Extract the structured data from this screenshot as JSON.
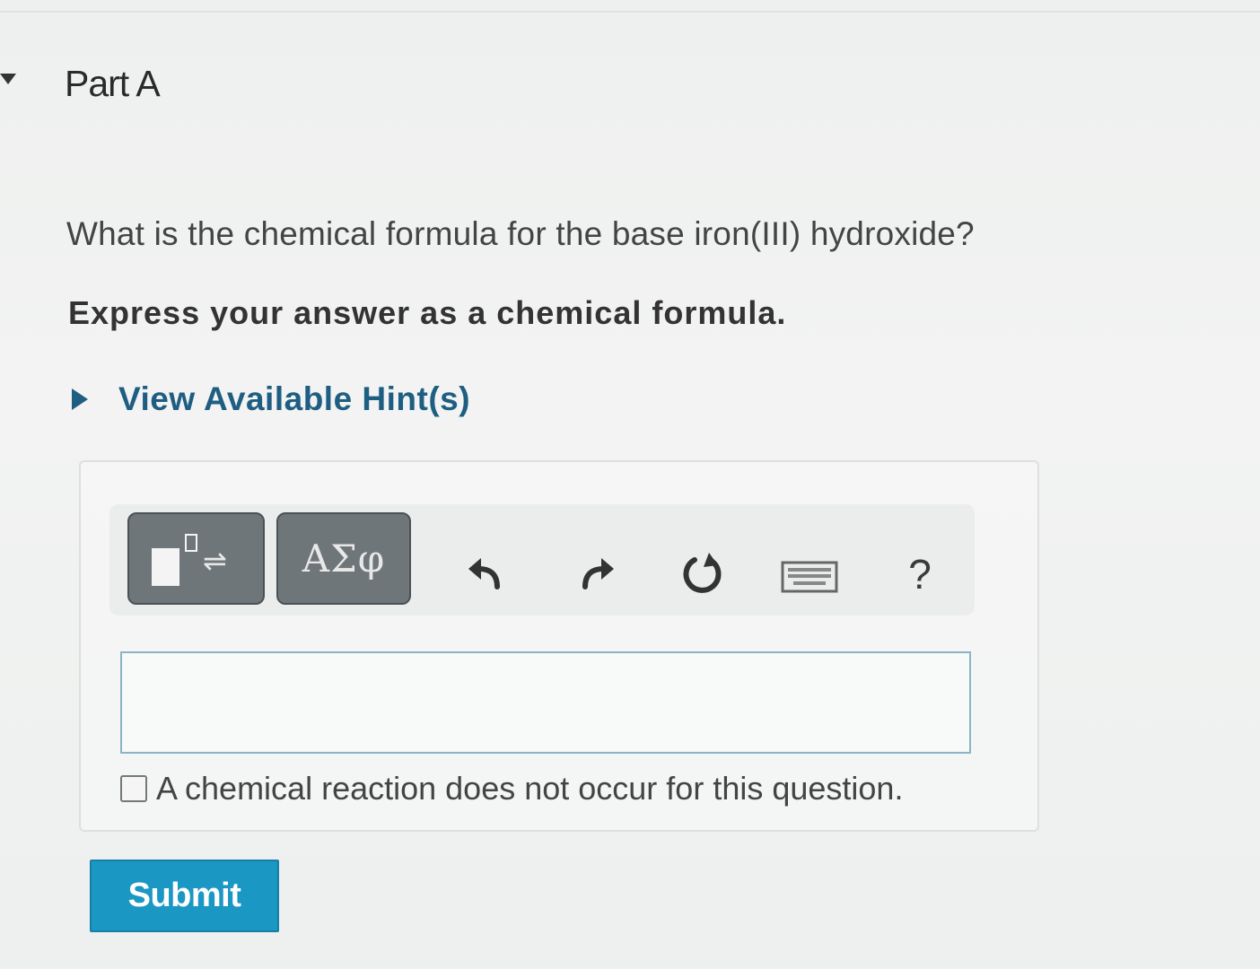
{
  "part": {
    "title": "Part A"
  },
  "question": {
    "text": "What is the chemical formula for the base iron(III) hydroxide?",
    "instruction": "Express your answer as a chemical formula."
  },
  "hints": {
    "label": "View Available Hint(s)"
  },
  "toolbar": {
    "symbols_label": "ΑΣφ",
    "template_arrows": "⇌",
    "help_label": "?",
    "icons": [
      "templates-icon",
      "greek-symbols-icon",
      "undo-icon",
      "redo-icon",
      "reset-icon",
      "keyboard-icon",
      "help-icon"
    ]
  },
  "answer": {
    "value": "",
    "no_reaction_label": "A chemical reaction does not occur for this question.",
    "no_reaction_checked": false
  },
  "actions": {
    "submit_label": "Submit"
  },
  "colors": {
    "link": "#1e5e82",
    "submit_bg": "#1b97c4",
    "tool_button_bg": "#6f7679",
    "input_border": "#8ab5c9"
  }
}
